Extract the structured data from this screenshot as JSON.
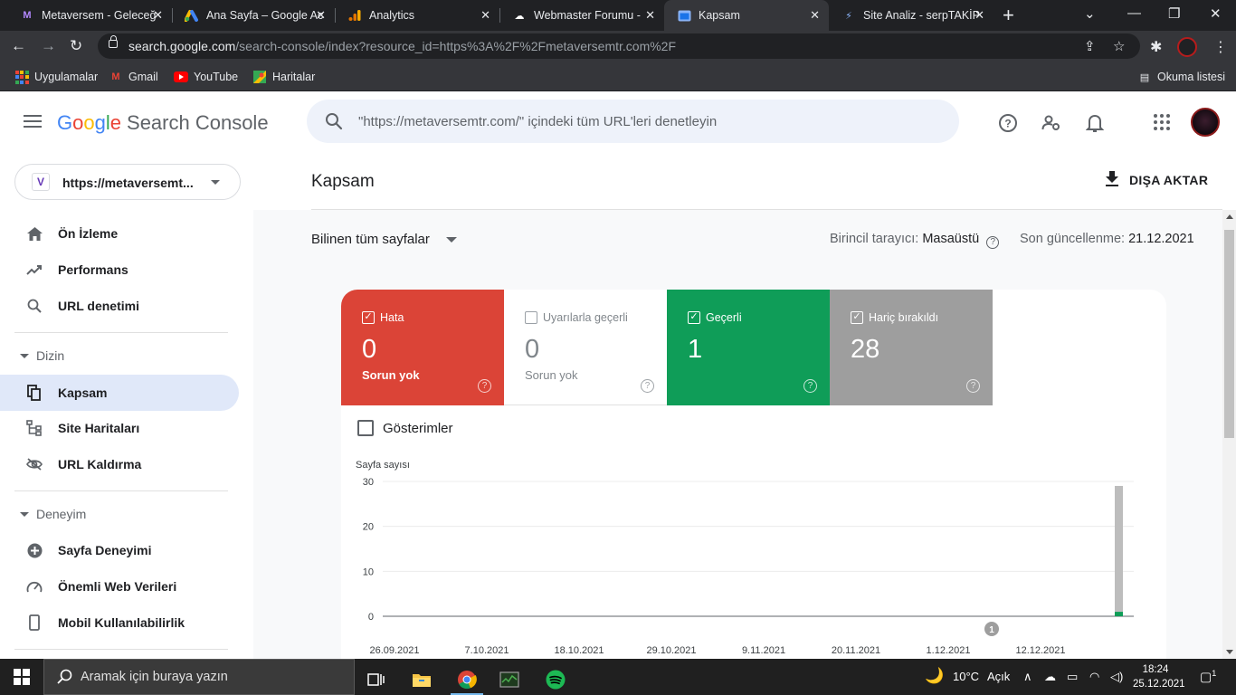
{
  "browser": {
    "tabs": [
      {
        "title": "Metaversem - Geleceğ",
        "icon": "metaversem-favicon"
      },
      {
        "title": "Ana Sayfa – Google Ac",
        "icon": "google-ads-favicon"
      },
      {
        "title": "Analytics",
        "icon": "analytics-favicon"
      },
      {
        "title": "Webmaster Forumu -",
        "icon": "webmaster-favicon"
      },
      {
        "title": "Kapsam",
        "icon": "search-console-favicon"
      },
      {
        "title": "Site Analiz - serpTAKİP",
        "icon": "serptakip-favicon"
      }
    ],
    "url_host": "search.google.com",
    "url_path": "/search-console/index?resource_id=https%3A%2F%2Fmetaversemtr.com%2F",
    "bookmarks": [
      "Uygulamalar",
      "Gmail",
      "YouTube",
      "Haritalar"
    ],
    "reading_list": "Okuma listesi"
  },
  "header": {
    "logo_google": "Google",
    "logo_product": "Search Console",
    "search_placeholder": "\"https://metaversemtr.com/\" içindeki tüm URL'leri denetleyin"
  },
  "sidebar": {
    "property_badge": "V",
    "property": "https://metaversemt...",
    "items_top": [
      {
        "label": "Ön İzleme",
        "icon": "home-icon"
      },
      {
        "label": "Performans",
        "icon": "trending-up-icon"
      },
      {
        "label": "URL denetimi",
        "icon": "search-icon"
      }
    ],
    "section_dizin": "Dizin",
    "items_dizin": [
      {
        "label": "Kapsam",
        "icon": "copy-icon"
      },
      {
        "label": "Site Haritaları",
        "icon": "sitemap-icon"
      },
      {
        "label": "URL Kaldırma",
        "icon": "eye-off-icon"
      }
    ],
    "section_deneyim": "Deneyim",
    "items_deneyim": [
      {
        "label": "Sayfa Deneyimi",
        "icon": "plus-circle-icon"
      },
      {
        "label": "Önemli Web Verileri",
        "icon": "speedometer-icon"
      },
      {
        "label": "Mobil Kullanılabilirlik",
        "icon": "mobile-icon"
      }
    ]
  },
  "main": {
    "title": "Kapsam",
    "export_label": "DIŞA AKTAR",
    "filter_label": "Bilinen tüm sayfalar",
    "crawler_label": "Birincil tarayıcı:",
    "crawler_value": "Masaüstü",
    "updated_label": "Son güncellenme:",
    "updated_value": "21.12.2021",
    "stats": {
      "error": {
        "label": "Hata",
        "value": "0",
        "sub": "Sorun yok",
        "checked": true,
        "color": "#db4437"
      },
      "warning": {
        "label": "Uyarılarla geçerli",
        "value": "0",
        "sub": "Sorun yok",
        "checked": false,
        "color": "#ffffff"
      },
      "valid": {
        "label": "Geçerli",
        "value": "1",
        "sub": "",
        "checked": true,
        "color": "#0f9d58"
      },
      "excluded": {
        "label": "Hariç bırakıldı",
        "value": "28",
        "sub": "",
        "checked": true,
        "color": "#9e9e9e"
      }
    },
    "impressions_label": "Gösterimler"
  },
  "chart_data": {
    "type": "bar",
    "ylabel": "Sayfa sayısı",
    "ylim": [
      0,
      30
    ],
    "yticks": [
      "30",
      "20",
      "10",
      "0"
    ],
    "xticks": [
      "26.09.2021",
      "7.10.2021",
      "18.10.2021",
      "29.10.2021",
      "9.11.2021",
      "20.11.2021",
      "1.12.2021",
      "12.12.2021"
    ],
    "series": [
      {
        "name": "Geçerli",
        "color": "#0f9d58",
        "values": [
          1
        ]
      },
      {
        "name": "Hariç bırakıldı",
        "color": "#bdbdbd",
        "values": [
          28
        ]
      }
    ],
    "annotation": "1"
  },
  "taskbar": {
    "search_placeholder": "Aramak için buraya yazın",
    "weather": "10°C",
    "weather_desc": "Açık",
    "time": "18:24",
    "date": "25.12.2021",
    "notifications": "1"
  }
}
